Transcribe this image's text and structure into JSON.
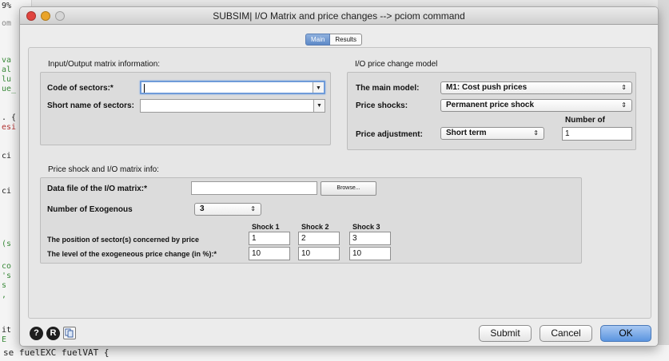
{
  "background": {
    "editor_lines": [
      "9%",
      "om",
      "va",
      "al",
      "lu",
      "ue_",
      ". {",
      "esi",
      "ci",
      "ci",
      "(s",
      "co",
      "'s",
      "s",
      ",",
      "it",
      "E",
      "se fuelEXC fuelVAT {"
    ]
  },
  "window": {
    "title": "SUBSIM| I/O Matrix and price changes --> pciom command",
    "tabs": {
      "main": "Main",
      "results": "Results"
    }
  },
  "io_matrix": {
    "group_title": "Input/Output matrix information:",
    "code_label": "Code of sectors:*",
    "code_value": "",
    "short_label": "Short name of sectors:",
    "short_value": ""
  },
  "price_model": {
    "group_title": "I/O price change model",
    "main_model_label": "The main model:",
    "main_model_value": "M1: Cost push prices",
    "shocks_label": "Price shocks:",
    "shocks_value": "Permanent  price shock",
    "adjustment_label": "Price adjustment:",
    "adjustment_value": "Short term",
    "number_of_label": "Number of",
    "number_of_value": "1"
  },
  "shock_info": {
    "group_title": "Price shock and I/O matrix info:",
    "data_file_label": "Data file of the I/O matrix:*",
    "data_file_value": "",
    "browse_label": "Browse...",
    "exogenous_label": "Number of Exogenous",
    "exogenous_value": "3",
    "shock_headers": [
      "Shock 1",
      "Shock 2",
      "Shock 3"
    ],
    "position_label": "The position of sector(s) concerned by  price",
    "position_values": [
      "1",
      "2",
      "3"
    ],
    "level_label": "The level of the exogeneous price change (in %):*",
    "level_values": [
      "10",
      "10",
      "10"
    ]
  },
  "footer": {
    "help_glyph": "?",
    "reset_glyph": "R",
    "copy_icon": "copy-icon",
    "submit": "Submit",
    "cancel": "Cancel",
    "ok": "OK"
  },
  "colors": {
    "accent": "#5b95e0",
    "close": "#e0443e",
    "minimize": "#e9a42a"
  }
}
